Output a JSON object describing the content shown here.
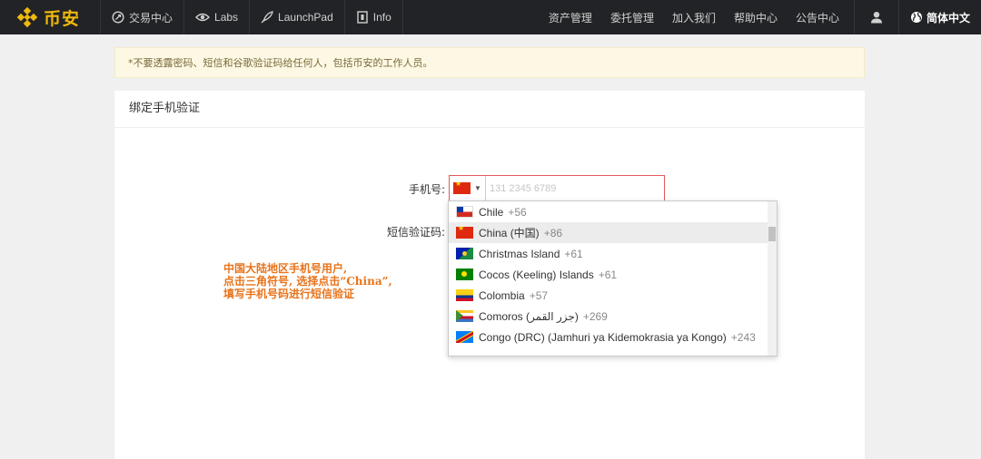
{
  "nav": {
    "logo_text": "币安",
    "left": [
      {
        "label": "交易中心",
        "icon": "exchange-circle-icon"
      },
      {
        "label": "Labs",
        "icon": "eye-icon"
      },
      {
        "label": "LaunchPad",
        "icon": "rocket-icon"
      },
      {
        "label": "Info",
        "icon": "document-icon"
      }
    ],
    "right": [
      "资产管理",
      "委托管理",
      "加入我们",
      "帮助中心",
      "公告中心"
    ],
    "language": "简体中文",
    "colors": {
      "bar": "#222326",
      "brand": "#f0b90b"
    }
  },
  "notice": {
    "text": "*不要透露密码、短信和谷歌验证码给任何人，包括币安的工作人员。"
  },
  "card": {
    "title": "绑定手机验证",
    "phone_label": "手机号:",
    "phone_placeholder": "131 2345 6789",
    "sms_label": "短信验证码:"
  },
  "dropdown": {
    "items": [
      {
        "name": "Chile",
        "dial": "+56",
        "flag": "cl"
      },
      {
        "name": "China (中国)",
        "dial": "+86",
        "flag": "cn",
        "selected": true
      },
      {
        "name": "Christmas Island",
        "dial": "+61",
        "flag": "cx"
      },
      {
        "name": "Cocos (Keeling) Islands",
        "dial": "+61",
        "flag": "cc"
      },
      {
        "name": "Colombia",
        "dial": "+57",
        "flag": "co"
      },
      {
        "name": "Comoros (جزر القمر)",
        "dial": "+269",
        "flag": "km"
      },
      {
        "name": "Congo (DRC) (Jamhuri ya Kidemokrasia ya Kongo)",
        "dial": "+243",
        "flag": "cd"
      }
    ]
  },
  "annotation": {
    "lines": [
      "中国大陆地区手机号用户,",
      "点击三角符号, 选择点击“China”,",
      "填写手机号码进行短信验证"
    ],
    "color": "#e8731a"
  }
}
